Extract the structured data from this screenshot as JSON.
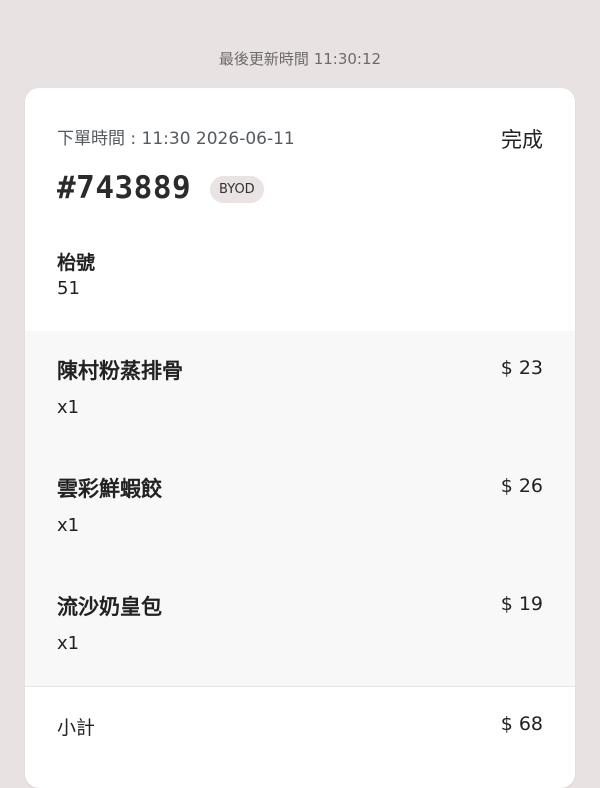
{
  "header": {
    "last_updated": "最後更新時間 11:30:12"
  },
  "order": {
    "order_time": "下單時間 : 11:30 2026-06-11",
    "status": "完成",
    "number": "#743889",
    "source_badge": "BYOD",
    "table_label": "枱號",
    "table_number": "51"
  },
  "items": [
    {
      "name": "陳村粉蒸排骨",
      "qty": "x1",
      "price": "$ 23"
    },
    {
      "name": "雲彩鮮蝦餃",
      "qty": "x1",
      "price": "$ 26"
    },
    {
      "name": "流沙奶皇包",
      "qty": "x1",
      "price": "$ 19"
    }
  ],
  "summary": {
    "subtotal_label": "小計",
    "subtotal_value": "$ 68"
  }
}
